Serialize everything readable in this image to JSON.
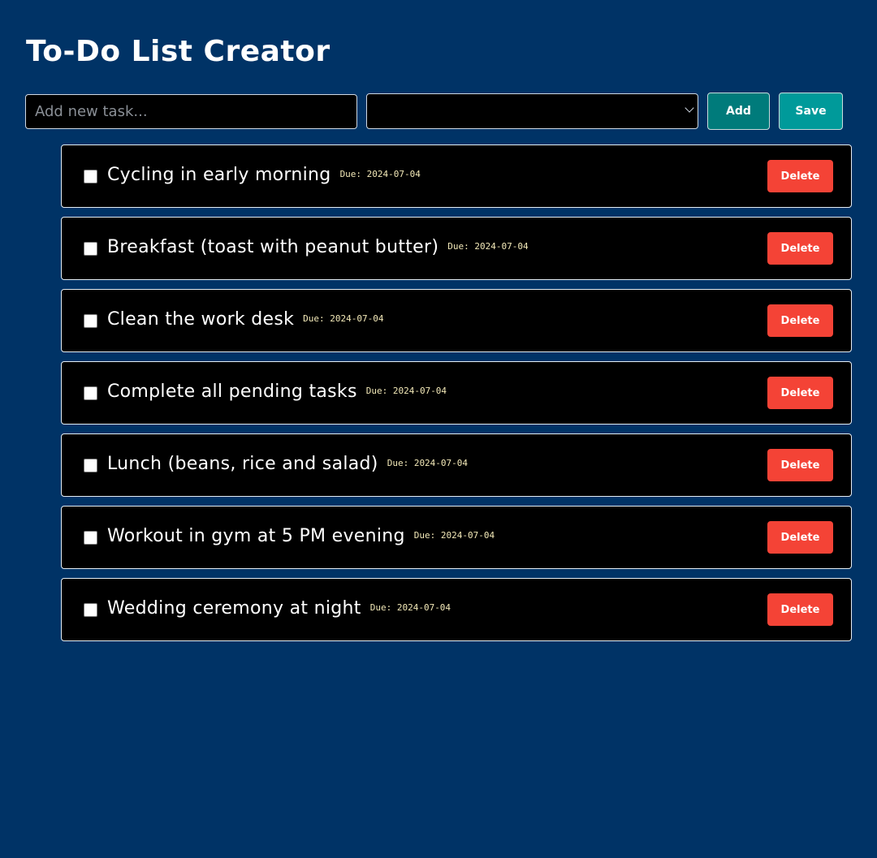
{
  "header": {
    "title": "To-Do List Creator"
  },
  "form": {
    "input_placeholder": "Add new task...",
    "input_value": "",
    "date_value": "",
    "add_label": "Add",
    "save_label": "Save"
  },
  "tasks": [
    {
      "label": "Cycling in early morning",
      "due": "Due: 2024-07-04",
      "done": false,
      "delete_label": "Delete"
    },
    {
      "label": "Breakfast (toast with peanut butter)",
      "due": "Due: 2024-07-04",
      "done": false,
      "delete_label": "Delete"
    },
    {
      "label": "Clean the work desk",
      "due": "Due: 2024-07-04",
      "done": false,
      "delete_label": "Delete"
    },
    {
      "label": "Complete all pending tasks",
      "due": "Due: 2024-07-04",
      "done": false,
      "delete_label": "Delete"
    },
    {
      "label": "Lunch (beans, rice and salad)",
      "due": "Due: 2024-07-04",
      "done": false,
      "delete_label": "Delete"
    },
    {
      "label": "Workout in gym at 5 PM evening",
      "due": "Due: 2024-07-04",
      "done": false,
      "delete_label": "Delete"
    },
    {
      "label": "Wedding ceremony at night",
      "due": "Due: 2024-07-04",
      "done": false,
      "delete_label": "Delete"
    }
  ],
  "colors": {
    "background": "#003366",
    "item_background": "#000000",
    "add_button": "#007b7b",
    "save_button": "#009a9a",
    "delete_button": "#f44336",
    "due_text": "#f3e9b8"
  },
  "icons": {
    "select_chevron": "chevron-down-icon",
    "task_checkbox": "checkbox-icon"
  }
}
